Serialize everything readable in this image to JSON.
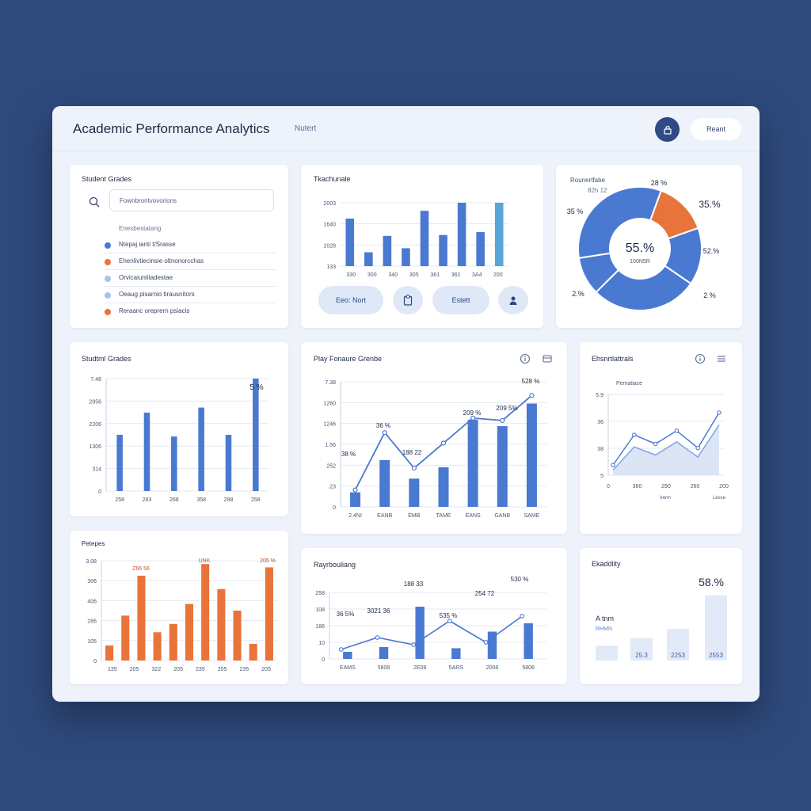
{
  "header": {
    "title": "Academic Performance Analytics",
    "nav_link": "Nutert",
    "button_label": "Reant"
  },
  "grades_list": {
    "title": "Student Grades",
    "search_placeholder": "Fownbrontvovorions",
    "section_label": "Enesbestatang",
    "items": [
      {
        "label": "Ntepaj ianti t/Srasse",
        "color": "#4a79d2"
      },
      {
        "label": "Ehenlivtiecinsie oltnonorcchas",
        "color": "#e8743b"
      },
      {
        "label": "Orvicaiuniitadestae",
        "color": "#a9c3ea"
      },
      {
        "label": "Oeaug pisarnio tirausnitors",
        "color": "#a9c3ea"
      },
      {
        "label": "Reraanc oreprern psiacis",
        "color": "#e8743b"
      }
    ]
  },
  "chart_panels": {
    "top_bar": {
      "title": "Tkachunale"
    },
    "donut": {
      "title": "Rounertfabe",
      "subtitle": "82h 12"
    },
    "mid_left": {
      "title": "Studtml Grades"
    },
    "mid_combo": {
      "title": "Play Fonaure Grenbe"
    },
    "mid_right": {
      "title": "Ehsnrtlattrals"
    },
    "bottom_orange": {
      "title": "Petepes"
    },
    "bottom_combo": {
      "title": "Rayrbouliang"
    },
    "bottom_right": {
      "title": "Ekaddlity"
    }
  },
  "top_buttons": {
    "left": "Eeo: Nort",
    "right": "Estett"
  },
  "chart_data": [
    {
      "type": "bar",
      "title": "Tkachunale",
      "categories": [
        "330",
        "300",
        "340",
        "305",
        "381",
        "361",
        "3A4",
        "200"
      ],
      "yticks": [
        "133",
        "1028",
        "1640",
        "2003"
      ],
      "ylim": [
        0,
        2200
      ],
      "values": [
        1650,
        480,
        1050,
        620,
        1920,
        1080,
        2300,
        1180,
        2300
      ],
      "colors": [
        "#4a79d2",
        "#4a79d2",
        "#4a79d2",
        "#4a79d2",
        "#4a79d2",
        "#4a79d2",
        "#4a79d2",
        "#4a79d2",
        "#58a6d8"
      ]
    },
    {
      "type": "pie",
      "title": "Rounertfabe",
      "center_label": "55.%",
      "center_sub": "100N5R",
      "slices": [
        {
          "label": "28 %",
          "value": 14,
          "color": "#e8743b"
        },
        {
          "label": "35.%",
          "value": 15,
          "color": "#4a79d2"
        },
        {
          "label": "52.%",
          "value": 28,
          "color": "#4a79d2"
        },
        {
          "label": "2 %",
          "value": 10,
          "color": "#4a79d2"
        },
        {
          "label": "35 %",
          "value": 33,
          "color": "#4a79d2"
        }
      ],
      "outer_labels": [
        "35 %",
        "28 %",
        "35.%",
        "52.%",
        "2 %",
        "2.%"
      ]
    },
    {
      "type": "bar",
      "title": "Studtml Grades",
      "categories": [
        "258",
        "283",
        "268",
        "358",
        "298",
        "258"
      ],
      "yticks": [
        "0",
        "314",
        "1306",
        "2206",
        "2856",
        "7.48"
      ],
      "ylim": [
        0,
        3300
      ],
      "values": [
        1650,
        2300,
        1600,
        2450,
        1650,
        3300
      ],
      "annotation": "5 %"
    },
    {
      "type": "bar",
      "title": "Play Fonaure Grenbe",
      "categories": [
        "2.4NI",
        "EANB",
        "EMB",
        "TAME",
        "EANS",
        "GANB",
        "SAME"
      ],
      "yticks": [
        "0",
        ".23",
        "252",
        "1.56",
        "1246",
        "1260",
        "7.38"
      ],
      "ylim": [
        0,
        1550
      ],
      "values": [
        180,
        580,
        350,
        490,
        1080,
        1000,
        1280
      ],
      "line_values": [
        210,
        920,
        480,
        790,
        1100,
        1070,
        1380
      ],
      "line_labels": [
        "38 %",
        "36 %",
        "188 22",
        "209 %",
        "209 5%",
        "528 %"
      ]
    },
    {
      "type": "area",
      "title": "Ehsnrtlattrals",
      "categories": [
        "0",
        "360",
        "290",
        "260",
        "200"
      ],
      "yticks": [
        "5",
        "38",
        "36",
        "5.9"
      ],
      "series": [
        {
          "values": [
            10,
            40,
            31,
            44,
            27,
            62
          ]
        },
        {
          "values": [
            5,
            28,
            20,
            33,
            18,
            50
          ]
        }
      ],
      "annotation": "Pematiace",
      "x_sublabels": [
        "Irenn",
        "Lesse"
      ]
    },
    {
      "type": "bar",
      "title": "Petepes",
      "categories": [
        "135",
        "205",
        "322",
        "205",
        "235",
        "205",
        "235",
        "205"
      ],
      "yticks": [
        "0",
        "105",
        "286",
        "406",
        "306",
        "3.08"
      ],
      "ylim": [
        0,
        600
      ],
      "values": [
        90,
        270,
        510,
        170,
        220,
        340,
        580,
        430,
        300,
        100,
        560
      ],
      "annotations": [
        "Z66 56",
        "UNK",
        "205 %"
      ]
    },
    {
      "type": "bar",
      "title": "Rayrbouliang",
      "categories": [
        "EAMS",
        "5808",
        "2E08",
        "5ARS",
        "2008",
        "5808"
      ],
      "yticks": [
        "0",
        "10",
        "186",
        "108",
        "258"
      ],
      "ylim": [
        0,
        280
      ],
      "values": [
        30,
        50,
        220,
        45,
        115,
        150
      ],
      "line_values": [
        40,
        90,
        60,
        160,
        70,
        180
      ],
      "line_labels": [
        "36 5%",
        "3021 36",
        "188 33",
        "535 %",
        "254 72",
        "530 %"
      ]
    },
    {
      "type": "bar",
      "title": "Ekaddlity",
      "values": [
        25,
        38,
        53,
        110
      ],
      "value_labels": [
        "",
        "25.3",
        "2253",
        "2553"
      ],
      "headline": "58.%",
      "side_label": "A tnm",
      "side_sub": "RHMN"
    }
  ]
}
